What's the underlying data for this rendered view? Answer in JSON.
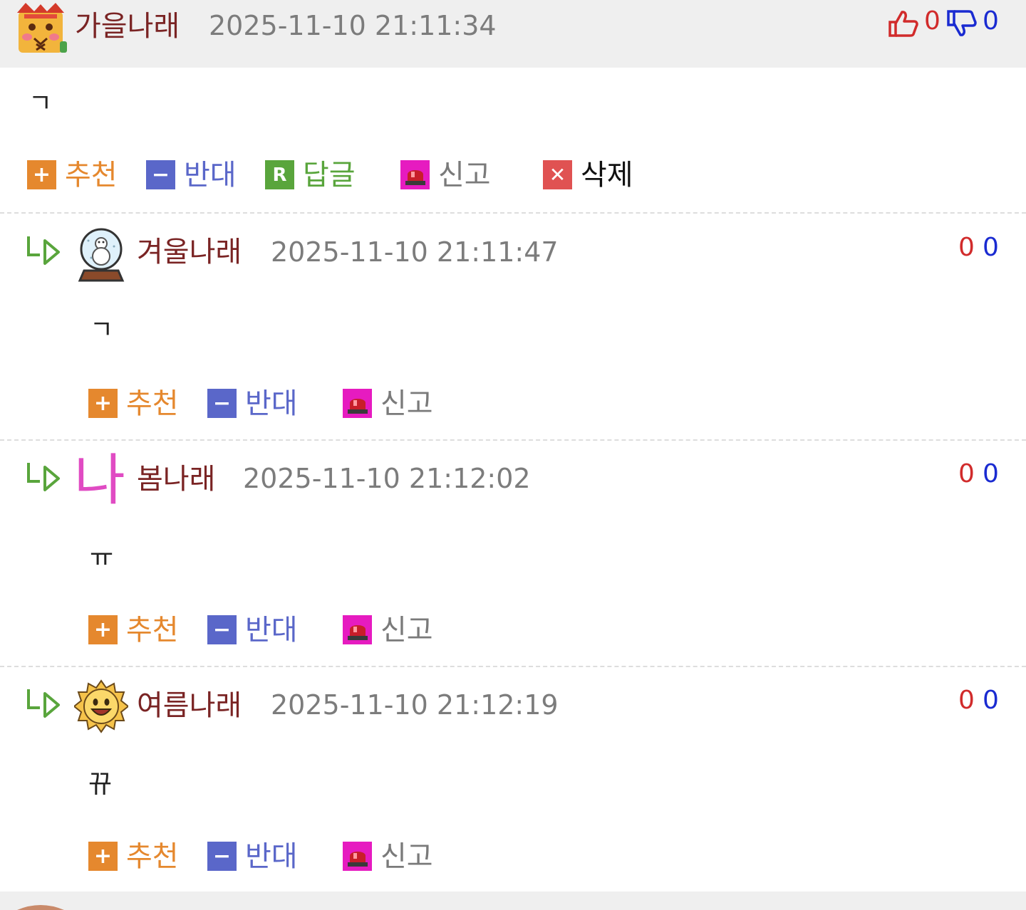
{
  "comments": [
    {
      "nickname": "가을나래",
      "timestamp": "2025-11-10 21:11:34",
      "likes": "0",
      "dislikes": "0",
      "body": "ㄱ",
      "actions": {
        "recommend": "추천",
        "oppose": "반대",
        "reply": "답글",
        "report": "신고",
        "delete": "삭제"
      },
      "avatar_icon": "tiger-avatar-icon"
    },
    {
      "nickname": "겨울나래",
      "timestamp": "2025-11-10 21:11:47",
      "likes": "0",
      "dislikes": "0",
      "body": "ㄱ",
      "actions": {
        "recommend": "추천",
        "oppose": "반대",
        "report": "신고"
      },
      "avatar_icon": "snow-globe-avatar-icon"
    },
    {
      "nickname": "봄나래",
      "timestamp": "2025-11-10 21:12:02",
      "likes": "0",
      "dislikes": "0",
      "body": "ㅠ",
      "actions": {
        "recommend": "추천",
        "oppose": "반대",
        "report": "신고"
      },
      "avatar_text": "나"
    },
    {
      "nickname": "여름나래",
      "timestamp": "2025-11-10 21:12:19",
      "likes": "0",
      "dislikes": "0",
      "body": "뀨",
      "actions": {
        "recommend": "추천",
        "oppose": "반대",
        "report": "신고"
      },
      "avatar_icon": "sun-avatar-icon"
    }
  ],
  "colors": {
    "nickname": "#7a2424",
    "timestamp": "#7c7c7c",
    "like": "#d12b2b",
    "dislike": "#1a2bd1",
    "recommend": "#e5882e",
    "oppose": "#5a67c9",
    "reply": "#59a53c",
    "report": "#e61bc0",
    "delete": "#e05252"
  },
  "icons": {
    "recommend": "plus-icon",
    "oppose": "minus-icon",
    "reply": "reply-r-icon",
    "report": "siren-icon",
    "delete": "close-icon",
    "thumbs_up": "thumbs-up-icon",
    "thumbs_down": "thumbs-down-icon",
    "reply_indicator": "reply-arrow-icon"
  }
}
